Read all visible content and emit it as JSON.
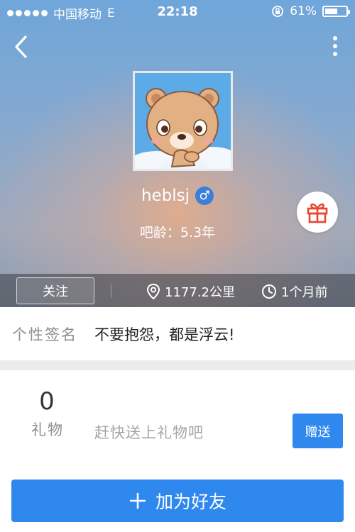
{
  "status_bar": {
    "carrier": "中国移动",
    "network": "E",
    "time": "22:18",
    "battery_percent": "61%",
    "battery_level": 0.61
  },
  "header": {
    "back_icon": "chevron-left-icon",
    "more_icon": "more-vertical-icon"
  },
  "profile": {
    "username": "heblsj",
    "gender_symbol": "♂",
    "bar_age": "吧龄：5.3年"
  },
  "info_strip": {
    "follow_label": "关注",
    "distance": "1177.2公里",
    "last_seen": "1个月前"
  },
  "signature": {
    "label": "个性签名",
    "text": "不要抱怨，都是浮云!"
  },
  "gifts": {
    "count": "0",
    "label": "礼物",
    "prompt": "赶快送上礼物吧",
    "send_label": "赠送"
  },
  "add_friend": {
    "label": "加为好友"
  },
  "colors": {
    "accent": "#2f88ee",
    "gender_badge": "#3a7fd8",
    "gift_red": "#e8452f"
  }
}
